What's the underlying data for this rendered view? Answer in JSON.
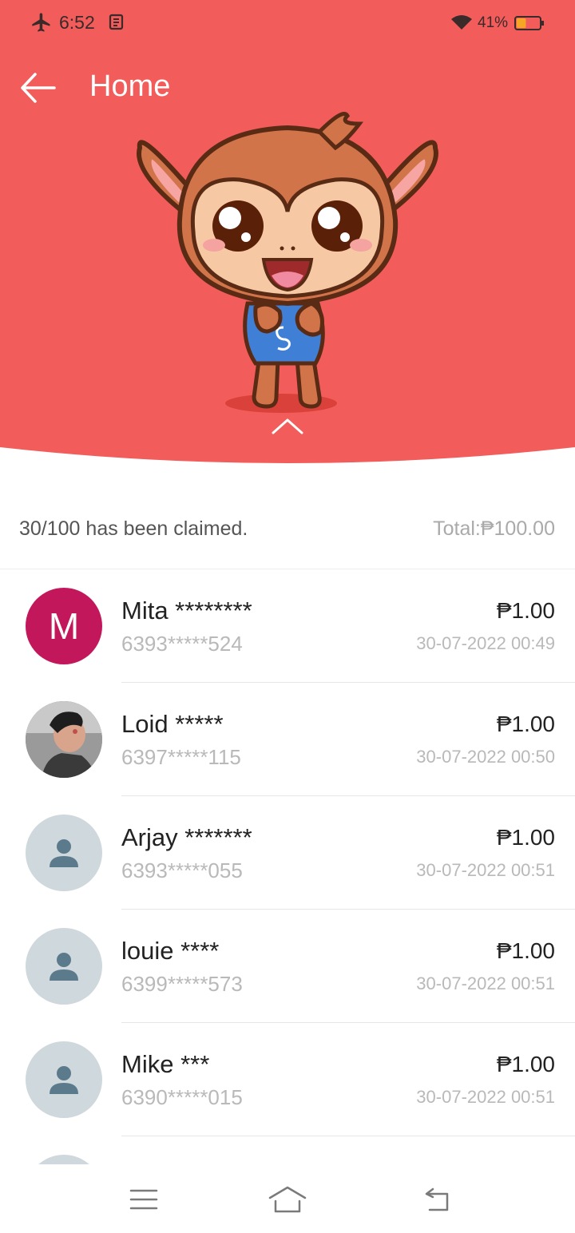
{
  "status_bar": {
    "time": "6:52",
    "battery_percent": "41%",
    "battery_level": 0.41
  },
  "header": {
    "title": "Home",
    "banner_color": "#f25c5a"
  },
  "summary": {
    "claimed_text": "30/100 has been claimed.",
    "total_text": "Total:₱100.00"
  },
  "claims": [
    {
      "avatar_type": "initial",
      "initial": "M",
      "name": "Mita ********",
      "phone": "6393*****524",
      "amount": "₱1.00",
      "date": "30-07-2022 00:49"
    },
    {
      "avatar_type": "photo",
      "name": "Loid *****",
      "phone": "6397*****115",
      "amount": "₱1.00",
      "date": "30-07-2022 00:50"
    },
    {
      "avatar_type": "default",
      "name": "Arjay *******",
      "phone": "6393*****055",
      "amount": "₱1.00",
      "date": "30-07-2022 00:51"
    },
    {
      "avatar_type": "default",
      "name": "louie ****",
      "phone": "6399*****573",
      "amount": "₱1.00",
      "date": "30-07-2022 00:51"
    },
    {
      "avatar_type": "default",
      "name": "Mike ***",
      "phone": "6390*****015",
      "amount": "₱1.00",
      "date": "30-07-2022 00:51"
    }
  ],
  "nav_icons": [
    "menu-icon",
    "home-icon",
    "back-icon"
  ]
}
